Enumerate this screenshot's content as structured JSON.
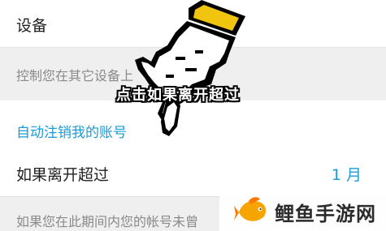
{
  "settings": {
    "device_label": "设备",
    "control_label": "控制您在其它设备上",
    "auto_logout_header": "自动注销我的账号",
    "leave_label": "如果离开超过",
    "leave_value": "1 月",
    "description": "如果您在此期间内您的帐号未曾"
  },
  "overlay": {
    "caption": "点击如果离开超过",
    "icon": "pixel-hand-pointer-icon"
  },
  "watermark": {
    "text": "鲤鱼手游网",
    "icon": "carp-fish-logo",
    "colors": {
      "fish_primary": "#f6a400",
      "fish_secondary": "#ff7a00"
    }
  },
  "colors": {
    "accent": "#1a9bd6",
    "muted_bg": "#efefef",
    "muted_text": "#8a8a8a",
    "cursor_highlight": "#f1c40f"
  }
}
